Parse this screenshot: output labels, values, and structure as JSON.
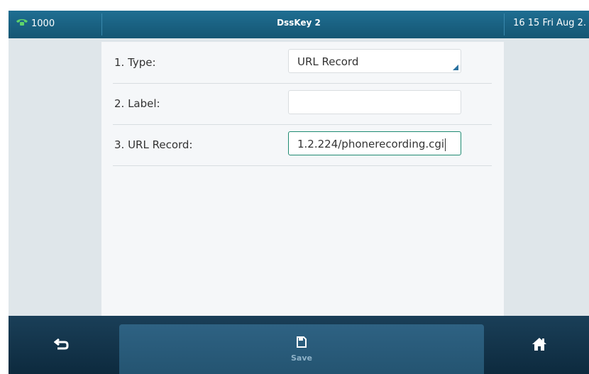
{
  "status": {
    "line": "1000",
    "title": "DssKey 2",
    "datetime": "16 15 Fri Aug 2."
  },
  "form": {
    "rows": [
      {
        "label": "1. Type:",
        "value": "URL Record"
      },
      {
        "label": "2. Label:",
        "value": ""
      },
      {
        "label": "3. URL Record:",
        "value": "1.2.224/phonerecording.cgi"
      }
    ]
  },
  "softkeys": {
    "save_label": "Save"
  },
  "icons": {
    "phone": "phone-handset-icon",
    "back": "back-arrow-icon",
    "save": "floppy-disk-icon",
    "home": "home-icon"
  }
}
